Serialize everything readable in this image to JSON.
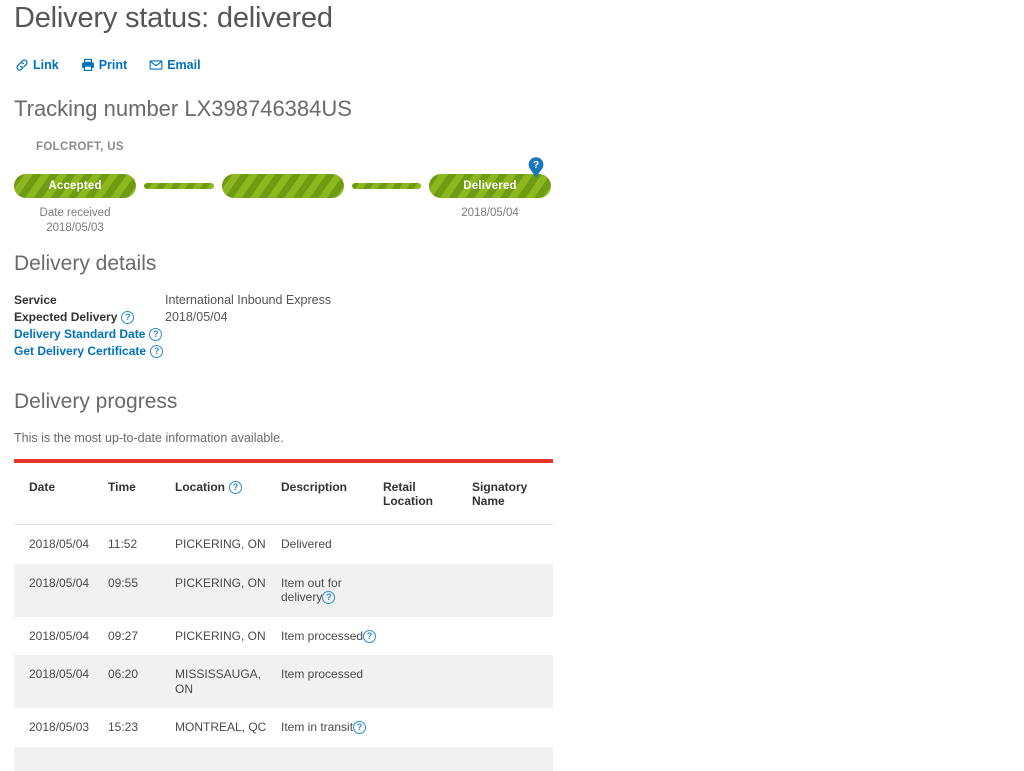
{
  "page": {
    "title": "Delivery status: delivered",
    "tracking_label": "Tracking number LX398746384US"
  },
  "actions": [
    {
      "label": "Link",
      "icon": "link-icon"
    },
    {
      "label": "Print",
      "icon": "printer-icon"
    },
    {
      "label": "Email",
      "icon": "envelope-icon"
    }
  ],
  "tracker": {
    "origin": "FOLCROFT, US",
    "steps": [
      {
        "label": "Accepted",
        "state": "complete"
      },
      {
        "label": "",
        "state": "complete"
      },
      {
        "label": "Delivered",
        "state": "complete"
      }
    ],
    "left_caption_line1": "Date received",
    "left_caption_line2": "2018/05/03",
    "right_caption": "2018/05/04",
    "help_badge": "?"
  },
  "details": {
    "heading": "Delivery details",
    "rows": [
      {
        "label": "Service",
        "value": "International Inbound Express",
        "help": false,
        "link": false
      },
      {
        "label": "Expected Delivery",
        "value": "2018/05/04",
        "help": true,
        "link": false
      },
      {
        "label": "Delivery Standard Date",
        "value": "",
        "help": true,
        "link": true
      },
      {
        "label": "Get Delivery Certificate",
        "value": "",
        "help": true,
        "link": true
      }
    ]
  },
  "progress": {
    "heading": "Delivery progress",
    "note": "This is the most up-to-date information available.",
    "columns": [
      {
        "label": "Date",
        "help": false
      },
      {
        "label": "Time",
        "help": false
      },
      {
        "label": "Location",
        "help": true
      },
      {
        "label": "Description",
        "help": false
      },
      {
        "label": "Retail\nLocation",
        "help": false
      },
      {
        "label": "Signatory\nName",
        "help": false
      }
    ],
    "rows": [
      {
        "date": "2018/05/04",
        "time": "11:52",
        "location": "PICKERING, ON",
        "description": "Delivered",
        "desc_help": false,
        "retail": "",
        "signatory": ""
      },
      {
        "date": "2018/05/04",
        "time": "09:55",
        "location": "PICKERING, ON",
        "description": "Item out for delivery",
        "desc_help": true,
        "retail": "",
        "signatory": ""
      },
      {
        "date": "2018/05/04",
        "time": "09:27",
        "location": "PICKERING, ON",
        "description": "Item processed",
        "desc_help": true,
        "retail": "",
        "signatory": ""
      },
      {
        "date": "2018/05/04",
        "time": "06:20",
        "location": "MISSISSAUGA, ON",
        "description": "Item processed",
        "desc_help": false,
        "retail": "",
        "signatory": ""
      },
      {
        "date": "2018/05/03",
        "time": "15:23",
        "location": "MONTREAL, QC",
        "description": "Item in transit",
        "desc_help": true,
        "retail": "",
        "signatory": ""
      },
      {
        "date": "",
        "time": "",
        "location": "",
        "description": "",
        "desc_help": false,
        "retail": "",
        "signatory": ""
      }
    ]
  },
  "colors": {
    "accent_red": "#e8352b",
    "green_light": "#8cb81e",
    "green_dark": "#6f9b12",
    "link_blue": "#0072bc",
    "help_blue": "#2d8bce"
  }
}
